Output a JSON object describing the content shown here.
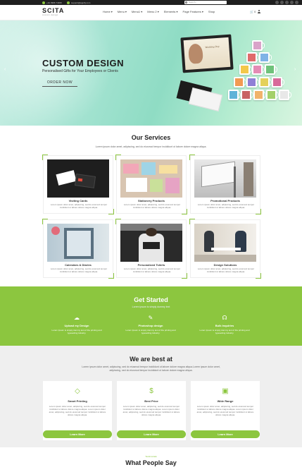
{
  "topbar": {
    "phone": "+91 9966 74935",
    "email": "support@appify.com",
    "search_placeholder": "Search..."
  },
  "nav": {
    "logo": "SCITA",
    "logo_sub": "custom design",
    "items": [
      "Home ▾",
      "Menu ▾",
      "Menu1 ▾",
      "Menu 2 ▾",
      "Elements ▾",
      "Page Features ▾",
      "Shop"
    ],
    "cart_count": "0"
  },
  "hero": {
    "title": "CUSTOM DESIGN",
    "subtitle": "Personalised Gifts for Your Employees or Clients",
    "button": "ORDER NOW",
    "prev": "‹",
    "next": "›",
    "frame_text": "Wedding Day"
  },
  "services": {
    "title": "Our Services",
    "lead": "Lorem ipsum dolor amet, adipiscing, sed do eiusmod tempor incididunt ut labore dolore magna aliqua.",
    "cards": [
      {
        "title": "Visiting Cards",
        "text": "Lorem ipsum dolor amet, adipiscing, sed do eiusmod tempor incididunt ut labore dolore magna aliqua."
      },
      {
        "title": "Stationery Products",
        "text": "Lorem ipsum dolor amet, adipiscing, sed do eiusmod tempor incididunt ut labore dolore magna aliqua."
      },
      {
        "title": "Promotional Products",
        "text": "Lorem ipsum dolor amet, adipiscing, sed do eiusmod tempor incididunt ut labore dolore magna aliqua."
      },
      {
        "title": "Calendars & Diaries",
        "text": "Lorem ipsum dolor amet, adipiscing, sed do eiusmod tempor incididunt ut labore dolore magna aliqua."
      },
      {
        "title": "Personalized Tshirts",
        "text": "Lorem ipsum dolor amet, adipiscing, sed do eiusmod tempor incididunt ut labore dolore magna aliqua."
      },
      {
        "title": "Design Solutions",
        "text": "Lorem ipsum dolor amet, adipiscing, sed do eiusmod tempor incididunt ut labore dolore magna aliqua."
      }
    ]
  },
  "get_started": {
    "title": "Get Started",
    "subtitle": "Lorem ipsum is simply dummy text",
    "items": [
      {
        "title": "Upload my Design",
        "text": "Lorem Ipsum is simply dummy text of the printing and typesetting industry."
      },
      {
        "title": "Photoshop design",
        "text": "Lorem Ipsum is simply dummy text of the printing and typesetting industry."
      },
      {
        "title": "Bulk Inquiries",
        "text": "Lorem Ipsum is simply dummy text of the printing and typesetting industry."
      }
    ]
  },
  "best": {
    "title": "We are best at",
    "lead": "Lorem ipsum dolor amet, adipiscing, sed do eiusmod tempor incididunt ut labore dolore magna aliqua.Lorem ipsum dolor amet, adipiscing, sed do eiusmod tempor incididunt ut labore dolore magna aliqua.",
    "cards": [
      {
        "title": "Smart Printing",
        "text": "Lorem ipsum dolor amet, adipiscing, sed do eiusmod tempor incididunt ut labore dolore magna aliqua. Lorem ipsum dolor amet, adipiscing, sed do eiusmod tempor incididunt ut labore dolore magna aliqua.",
        "button": "Learn More",
        "icon": "diamond-icon"
      },
      {
        "title": "Best Price",
        "text": "Lorem ipsum dolor amet, adipiscing, sed do eiusmod tempor incididunt ut labore dolore magna aliqua. Lorem ipsum dolor amet, adipiscing, sed do eiusmod tempor incididunt ut labore dolore magna aliqua.",
        "button": "Learn More",
        "icon": "dollar-icon"
      },
      {
        "title": "Wide Range",
        "text": "Lorem ipsum dolor amet, adipiscing, sed do eiusmod tempor incididunt ut labore dolore magna aliqua. Lorem ipsum dolor amet, adipiscing, sed do eiusmod tempor incididunt ut labore dolore magna aliqua.",
        "button": "Learn More",
        "icon": "image-icon"
      }
    ]
  },
  "testimonials": {
    "eyebrow": "Testimonials",
    "title": "What People Say"
  },
  "colors": {
    "accent": "#8cc63f",
    "dark": "#1f1f1f"
  }
}
